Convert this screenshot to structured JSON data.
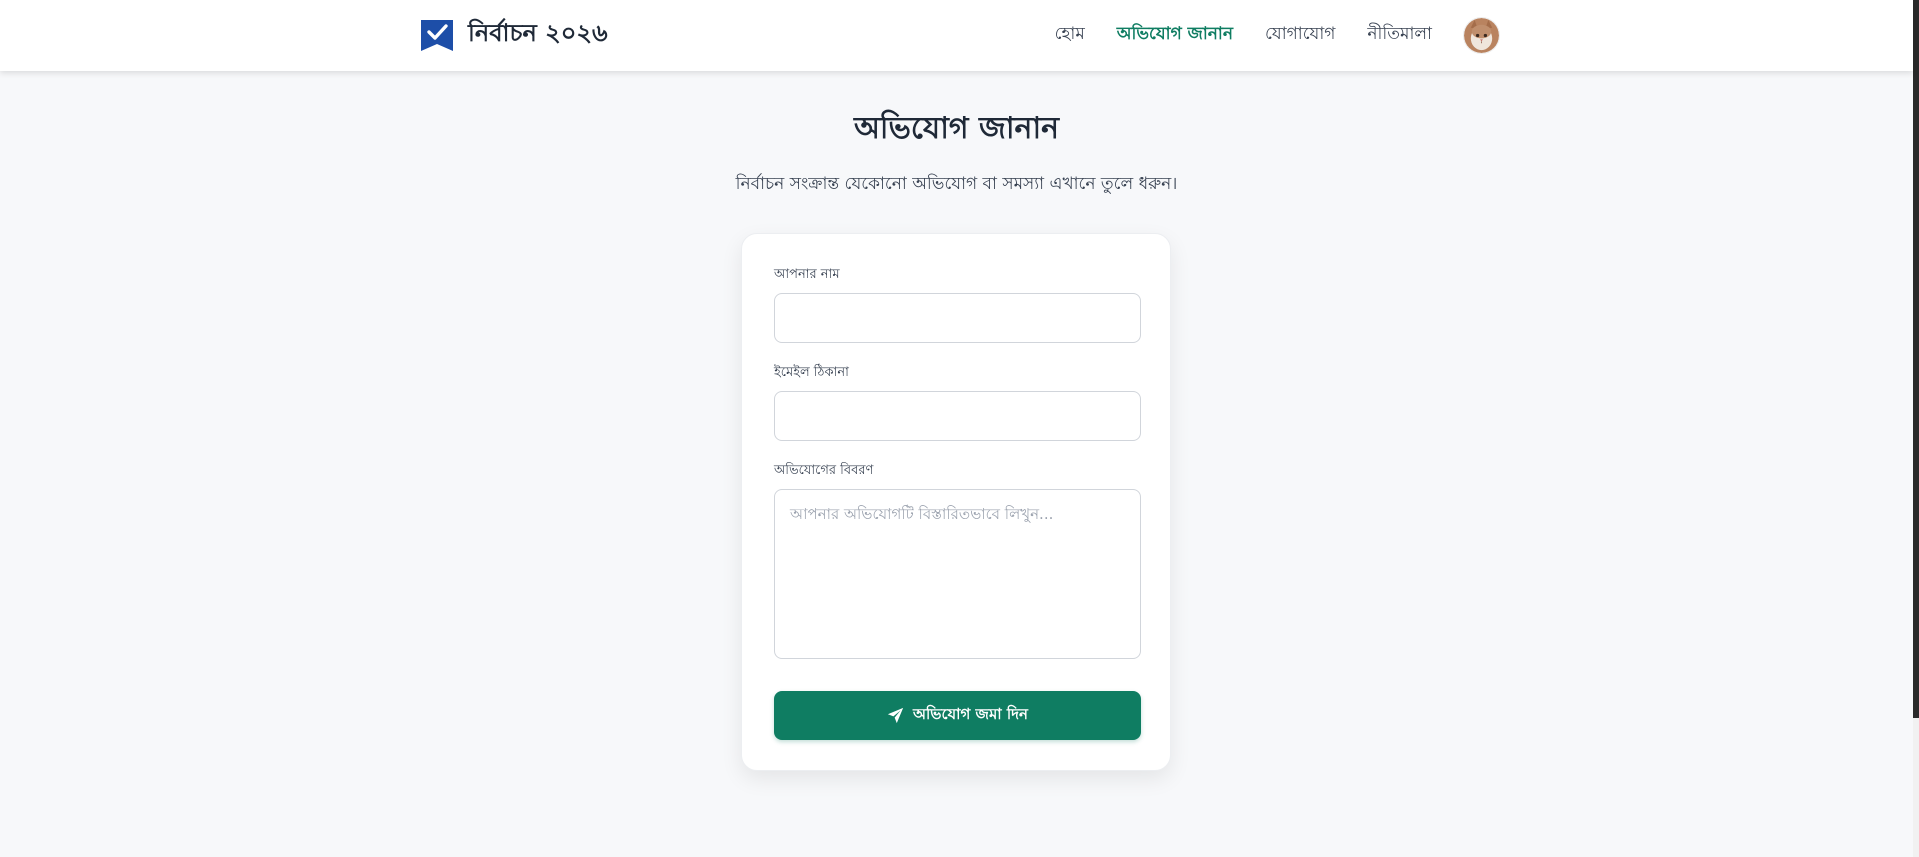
{
  "header": {
    "brand_title": "নির্বাচন ২০২৬",
    "logo_icon": "ballot-check-icon",
    "nav": {
      "home": "হোম",
      "complaint": "অভিযোগ জানান",
      "contact": "যোগাযোগ",
      "policy": "নীতিমালা"
    },
    "active_nav": "complaint",
    "avatar_icon": "user-avatar-icon"
  },
  "main": {
    "title": "অভিযোগ জানান",
    "subtitle": "নির্বাচন সংক্রান্ত যেকোনো অভিযোগ বা সমস্যা এখানে তুলে ধরুন।"
  },
  "form": {
    "name_label": "আপনার নাম",
    "name_value": "",
    "email_label": "ইমেইল ঠিকানা",
    "email_value": "",
    "details_label": "অভিযোগের বিবরণ",
    "details_placeholder": "আপনার অভিযোগটি বিস্তারিতভাবে লিখুন...",
    "details_value": "",
    "submit_label": "অভিযোগ জমা দিন",
    "submit_icon": "paper-plane-icon"
  },
  "colors": {
    "brand_green": "#0f7d62",
    "logo_blue": "#1d4ea8",
    "page_background": "#f7f8fa"
  }
}
